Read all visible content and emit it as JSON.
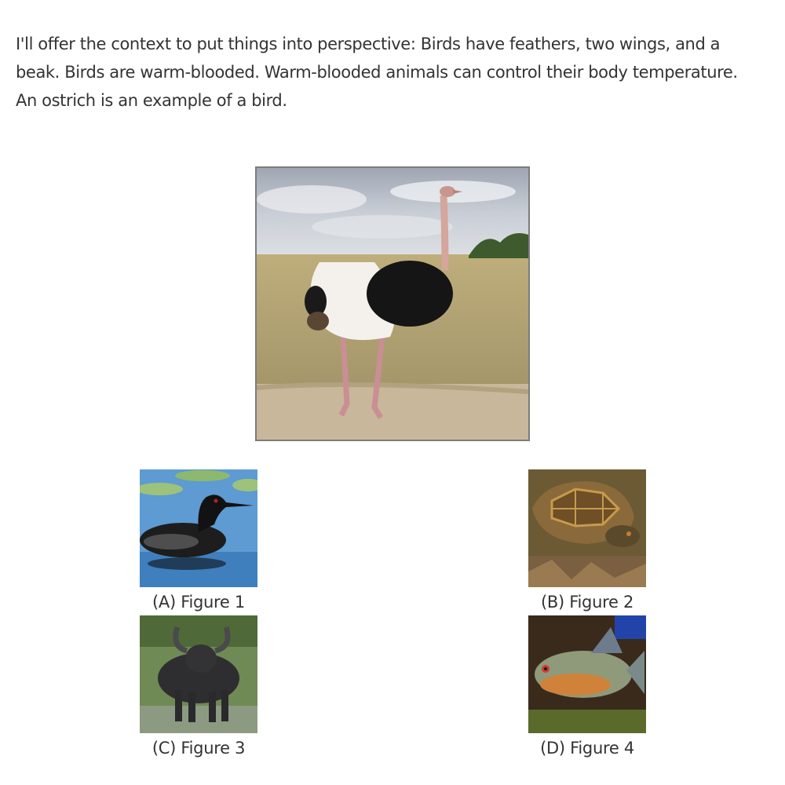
{
  "context_text": "I'll offer the context to put things into perspective: Birds have feathers, two wings, and a beak. Birds are warm-blooded. Warm-blooded animals can control their body temperature. An ostrich is an example of a bird.",
  "main_image": {
    "subject": "ostrich"
  },
  "choices": [
    {
      "label": "(A) Figure 1",
      "subject": "loon"
    },
    {
      "label": "(B) Figure 2",
      "subject": "box turtle"
    },
    {
      "label": "(C) Figure 3",
      "subject": "water buffalo"
    },
    {
      "label": "(D) Figure 4",
      "subject": "piranha"
    }
  ],
  "colors": {
    "text": "#333333",
    "image_border": "#7c7c7c"
  }
}
